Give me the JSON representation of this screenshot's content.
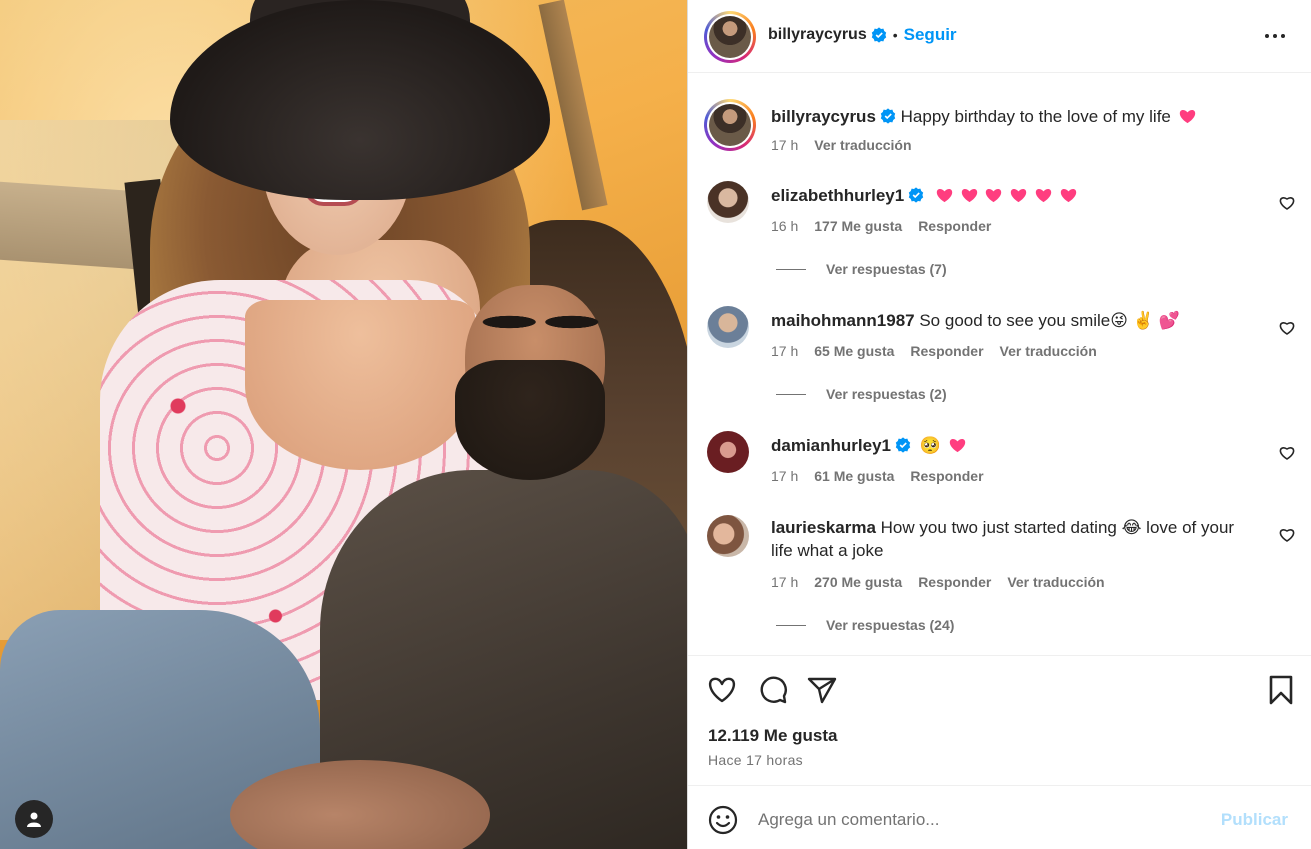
{
  "post": {
    "author": "billyraycyrus",
    "follow_label": "Seguir",
    "separator": "•"
  },
  "caption": {
    "username": "billyraycyrus",
    "text": "Happy birthday to the love of my life",
    "time": "17 h",
    "translate": "Ver traducción"
  },
  "comments": [
    {
      "username": "elizabethhurley1",
      "verified": true,
      "text": "",
      "hearts": 6,
      "time": "16 h",
      "likes": "177 Me gusta",
      "reply": "Responder",
      "replies": "Ver respuestas (7)"
    },
    {
      "username": "maihohmann1987",
      "verified": false,
      "text": "So good to see you smile😜 ✌️ 💕",
      "time": "17 h",
      "likes": "65 Me gusta",
      "reply": "Responder",
      "translate": "Ver traducción",
      "replies": "Ver respuestas (2)"
    },
    {
      "username": "damianhurley1",
      "verified": true,
      "text": "🥺",
      "hearts": 1,
      "time": "17 h",
      "likes": "61 Me gusta",
      "reply": "Responder"
    },
    {
      "username": "laurieskarma",
      "verified": false,
      "text": "How you two just started dating 😂 love of your life what a joke",
      "time": "17 h",
      "likes": "270 Me gusta",
      "reply": "Responder",
      "translate": "Ver traducción",
      "replies": "Ver respuestas (24)"
    }
  ],
  "actions": {
    "likes": "12.119 Me gusta",
    "time": "Hace 17 horas"
  },
  "composer": {
    "placeholder": "Agrega un comentario...",
    "publish": "Publicar"
  },
  "colors": {
    "accent": "#0095f6",
    "heart": "#ff3d7f",
    "muted": "#737373",
    "publish_disabled": "#b2dffc"
  },
  "icons": [
    "more-icon",
    "verified-icon",
    "heart-icon",
    "comment-icon",
    "share-icon",
    "bookmark-icon",
    "emoji-icon",
    "user-icon"
  ]
}
